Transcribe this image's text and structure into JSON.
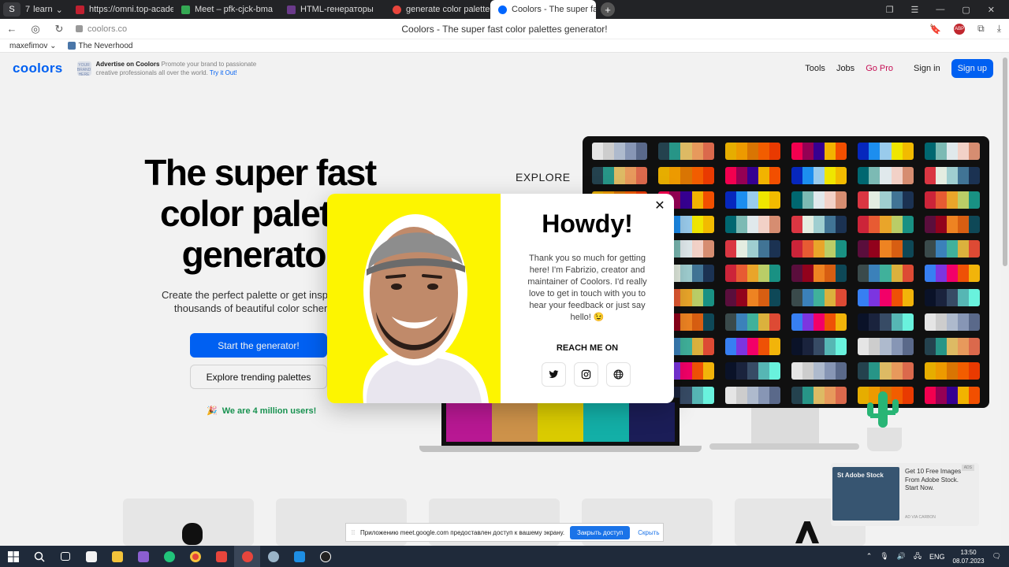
{
  "browser": {
    "tabs": [
      {
        "label": "learn",
        "active": false
      },
      {
        "label": "https://omni.top-academy",
        "active": false
      },
      {
        "label": "Meet – pfk-cjck-bma",
        "active": false
      },
      {
        "label": "HTML-генераторы",
        "active": false
      },
      {
        "label": "generate color palette —",
        "active": false
      },
      {
        "label": "Coolors - The super fas",
        "active": true
      }
    ],
    "tab_counter": "7",
    "new_tab": "+",
    "url": "coolors.co",
    "page_title": "Coolors - The super fast color palettes generator!",
    "abp": "ABP",
    "bookmarks": [
      {
        "label": "maxefimov ⌄"
      },
      {
        "label": "The Neverhood"
      }
    ]
  },
  "site": {
    "logo": "coolors",
    "ad": {
      "badge": "YOUR BRAND HERE",
      "title": "Advertise on Coolors",
      "body": "Promote your brand to passionate creative professionals all over the world.",
      "cta": "Try it Out!"
    },
    "nav": {
      "tools": "Tools",
      "jobs": "Jobs",
      "go_pro": "Go Pro",
      "sign_in": "Sign in",
      "sign_up": "Sign up"
    },
    "hero": {
      "title": "The super fast color palette generator",
      "subtitle": "Create the perfect palette or get inspired by thousands of beautiful color schemes.",
      "start_btn": "Start the generator!",
      "explore_btn": "Explore trending palettes",
      "users": "We are 4 million users!"
    },
    "explore_tag": "EXPLORE",
    "side_ad": {
      "brand": "St  Adobe Stock",
      "copy": "Get 10 Free Images From Adobe Stock. Start Now.",
      "footer": "AD VIA CARBON",
      "badge": "ADS"
    }
  },
  "modal": {
    "close": "✕",
    "heading": "Howdy!",
    "message": "Thank you so much for getting here! I'm Fabrizio, creator and maintainer of Coolors. I'd really love to get in touch with you to hear your feedback or just say hello! 😉",
    "reach": "REACH ME ON",
    "socials": [
      "twitter-icon",
      "instagram-icon",
      "globe-icon"
    ]
  },
  "share_banner": {
    "grip": "⁞⁞",
    "text": "Приложению meet.google.com предоставлен доступ к вашему экрану.",
    "stop": "Закрыть доступ",
    "hide": "Скрыть"
  },
  "taskbar": {
    "lang": "ENG",
    "time": "13:50",
    "date": "08.07.2023"
  },
  "colors": {
    "coolors_blue": "#0066ff",
    "go_pro": "#d1115a",
    "photo_bg": "#fdf500"
  }
}
